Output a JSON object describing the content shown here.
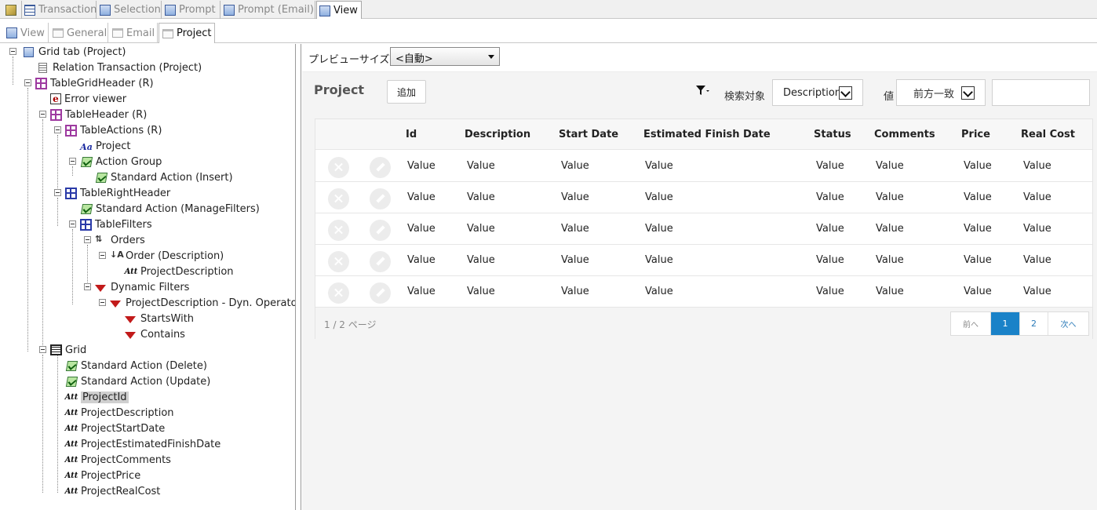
{
  "tabs_top": [
    {
      "label": ""
    },
    {
      "label": "Transaction"
    },
    {
      "label": "Selection"
    },
    {
      "label": "Prompt"
    },
    {
      "label": "Prompt (Email)"
    },
    {
      "label": "View"
    }
  ],
  "tabs_sub": [
    {
      "label": "View"
    },
    {
      "label": "General"
    },
    {
      "label": "Email"
    },
    {
      "label": "Project"
    }
  ],
  "tree": {
    "nodes": [
      "Grid tab (Project)",
      "Relation Transaction (Project)",
      "TableGridHeader (R)",
      "Error viewer",
      "TableHeader (R)",
      "TableActions (R)",
      "Project",
      "Action Group",
      "Standard Action (Insert)",
      "TableRightHeader",
      "Standard Action (ManageFilters)",
      "TableFilters",
      "Orders",
      "Order (Description)",
      "ProjectDescription",
      "Dynamic Filters",
      "ProjectDescription - Dyn. Operator",
      "StartsWith",
      "Contains",
      "Grid",
      "Standard Action (Delete)",
      "Standard Action (Update)",
      "ProjectId",
      "ProjectDescription",
      "ProjectStartDate",
      "ProjectEstimatedFinishDate",
      "ProjectComments",
      "ProjectPrice",
      "ProjectRealCost"
    ]
  },
  "preview": {
    "label": "プレビューサイズ",
    "size_value": "<自動>"
  },
  "panel": {
    "title": "Project",
    "add_button": "追加",
    "search_label": "検索対象",
    "search_field": "Description",
    "value_label": "値",
    "operator": "前方一致",
    "value_input": ""
  },
  "grid": {
    "columns": [
      "Id",
      "Description",
      "Start Date",
      "Estimated Finish Date",
      "Status",
      "Comments",
      "Price",
      "Real Cost"
    ],
    "rows": [
      [
        "Value",
        "Value",
        "Value",
        "Value",
        "Value",
        "Value",
        "Value",
        "Value"
      ],
      [
        "Value",
        "Value",
        "Value",
        "Value",
        "Value",
        "Value",
        "Value",
        "Value"
      ],
      [
        "Value",
        "Value",
        "Value",
        "Value",
        "Value",
        "Value",
        "Value",
        "Value"
      ],
      [
        "Value",
        "Value",
        "Value",
        "Value",
        "Value",
        "Value",
        "Value",
        "Value"
      ],
      [
        "Value",
        "Value",
        "Value",
        "Value",
        "Value",
        "Value",
        "Value",
        "Value"
      ]
    ]
  },
  "pager": {
    "status": "1 / 2 ページ",
    "prev": "前へ",
    "pages": [
      "1",
      "2"
    ],
    "current": "1",
    "next": "次へ"
  }
}
